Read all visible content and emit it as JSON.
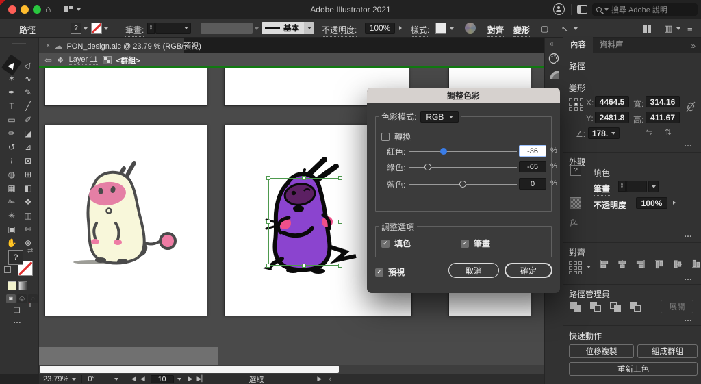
{
  "titlebar": {
    "app_title": "Adobe Illustrator 2021",
    "search_placeholder": "搜尋 Adobe 說明"
  },
  "controlbar": {
    "selection_label": "路徑",
    "fill_glyph": "?",
    "stroke_label": "筆畫:",
    "stroke_style": "基本",
    "opacity_label": "不透明度:",
    "opacity_value": "100%",
    "style_label": "樣式:",
    "align_label": "對齊",
    "transform_label": "變形"
  },
  "tabbar": {
    "close": "×",
    "doc_title": "PON_design.aic @ 23.79 % (RGB/預視)"
  },
  "breadcrumb": {
    "layer": "Layer 11",
    "group": "<群組>"
  },
  "toolbar": {
    "tools": [
      {
        "name": "selection-tool",
        "glyph": "▶",
        "selected": true
      },
      {
        "name": "direct-selection-tool",
        "glyph": "▷",
        "selected": false
      },
      {
        "name": "magic-wand-tool",
        "glyph": "✶",
        "selected": false
      },
      {
        "name": "lasso-tool",
        "glyph": "∿",
        "selected": false
      },
      {
        "name": "pen-tool",
        "glyph": "✒",
        "selected": false
      },
      {
        "name": "curvature-tool",
        "glyph": "✎",
        "selected": false
      },
      {
        "name": "type-tool",
        "glyph": "T",
        "selected": false
      },
      {
        "name": "line-segment-tool",
        "glyph": "╱",
        "selected": false
      },
      {
        "name": "rectangle-tool",
        "glyph": "▭",
        "selected": false
      },
      {
        "name": "paintbrush-tool",
        "glyph": "✐",
        "selected": false
      },
      {
        "name": "shaper-tool",
        "glyph": "✏",
        "selected": false
      },
      {
        "name": "eraser-tool",
        "glyph": "◪",
        "selected": false
      },
      {
        "name": "rotate-tool",
        "glyph": "↺",
        "selected": false
      },
      {
        "name": "scale-tool",
        "glyph": "⊿",
        "selected": false
      },
      {
        "name": "width-tool",
        "glyph": "≀",
        "selected": false
      },
      {
        "name": "free-transform-tool",
        "glyph": "⊠",
        "selected": false
      },
      {
        "name": "shape-builder-tool",
        "glyph": "◍",
        "selected": false
      },
      {
        "name": "perspective-grid-tool",
        "glyph": "⊞",
        "selected": false
      },
      {
        "name": "mesh-tool",
        "glyph": "▦",
        "selected": false
      },
      {
        "name": "gradient-tool",
        "glyph": "◧",
        "selected": false
      },
      {
        "name": "eyedropper-tool",
        "glyph": "✁",
        "selected": false
      },
      {
        "name": "blend-tool",
        "glyph": "❖",
        "selected": false
      },
      {
        "name": "symbol-sprayer-tool",
        "glyph": "✳",
        "selected": false
      },
      {
        "name": "graph-tool",
        "glyph": "◫",
        "selected": false
      },
      {
        "name": "artboard-tool",
        "glyph": "▣",
        "selected": false
      },
      {
        "name": "slice-tool",
        "glyph": "✄",
        "selected": false
      },
      {
        "name": "hand-tool",
        "glyph": "✋",
        "selected": false
      },
      {
        "name": "zoom-tool",
        "glyph": "⊕",
        "selected": false
      }
    ],
    "fill_glyph": "?"
  },
  "dialog": {
    "title": "調整色彩",
    "color_mode_label": "色彩模式:",
    "color_mode_value": "RGB",
    "convert_label": "轉換",
    "sliders": [
      {
        "label": "紅色:",
        "value": -36,
        "display": "-36",
        "unit": "%",
        "focused": true
      },
      {
        "label": "綠色:",
        "value": -65,
        "display": "-65",
        "unit": "%",
        "focused": false
      },
      {
        "label": "藍色:",
        "value": 0,
        "display": "0",
        "unit": "%",
        "focused": false
      }
    ],
    "options_title": "調整選項",
    "fill_option": "填色",
    "stroke_option": "筆畫",
    "preview_label": "預視",
    "cancel_label": "取消",
    "ok_label": "確定"
  },
  "rightpanel": {
    "tabs": [
      "內容",
      "資料庫"
    ],
    "path_title": "路徑",
    "transform": {
      "title": "變形",
      "x_label": "X:",
      "x_value": "4464.5",
      "y_label": "Y:",
      "y_value": "2481.8",
      "w_label": "寬:",
      "w_value": "314.16",
      "h_label": "高:",
      "h_value": "411.67",
      "angle_label": "∠:",
      "angle_value": "178."
    },
    "appearance": {
      "title": "外觀",
      "fill_label": "填色",
      "fill_glyph": "?",
      "stroke_label": "筆畫",
      "opacity_label": "不透明度",
      "opacity_value": "100%",
      "fx_label": "fx."
    },
    "align": {
      "title": "對齊",
      "icons": [
        "align-left",
        "align-h-center",
        "align-right",
        "align-top",
        "align-v-center",
        "align-bottom"
      ]
    },
    "pathfinder": {
      "title": "路徑管理員",
      "icons": [
        "unite",
        "minus-front",
        "intersect",
        "exclude"
      ],
      "expand_label": "展開"
    },
    "quick": {
      "title": "快速動作",
      "offset_copy": "位移複製",
      "group": "組成群組",
      "recolor": "重新上色"
    }
  },
  "statusbar": {
    "zoom": "23.79%",
    "rotation": "0°",
    "artboard_number": "10",
    "status_text": "選取"
  },
  "colors": {
    "accent_blue": "#3a7de8",
    "selection_green": "#4e9a4e",
    "dialog_header": "#d6d1ce",
    "creature_cream": "#f8f7da",
    "creature_purple": "#8b44cf",
    "pink": "#ee7ba4",
    "stroke_none_red": "#e03131"
  }
}
